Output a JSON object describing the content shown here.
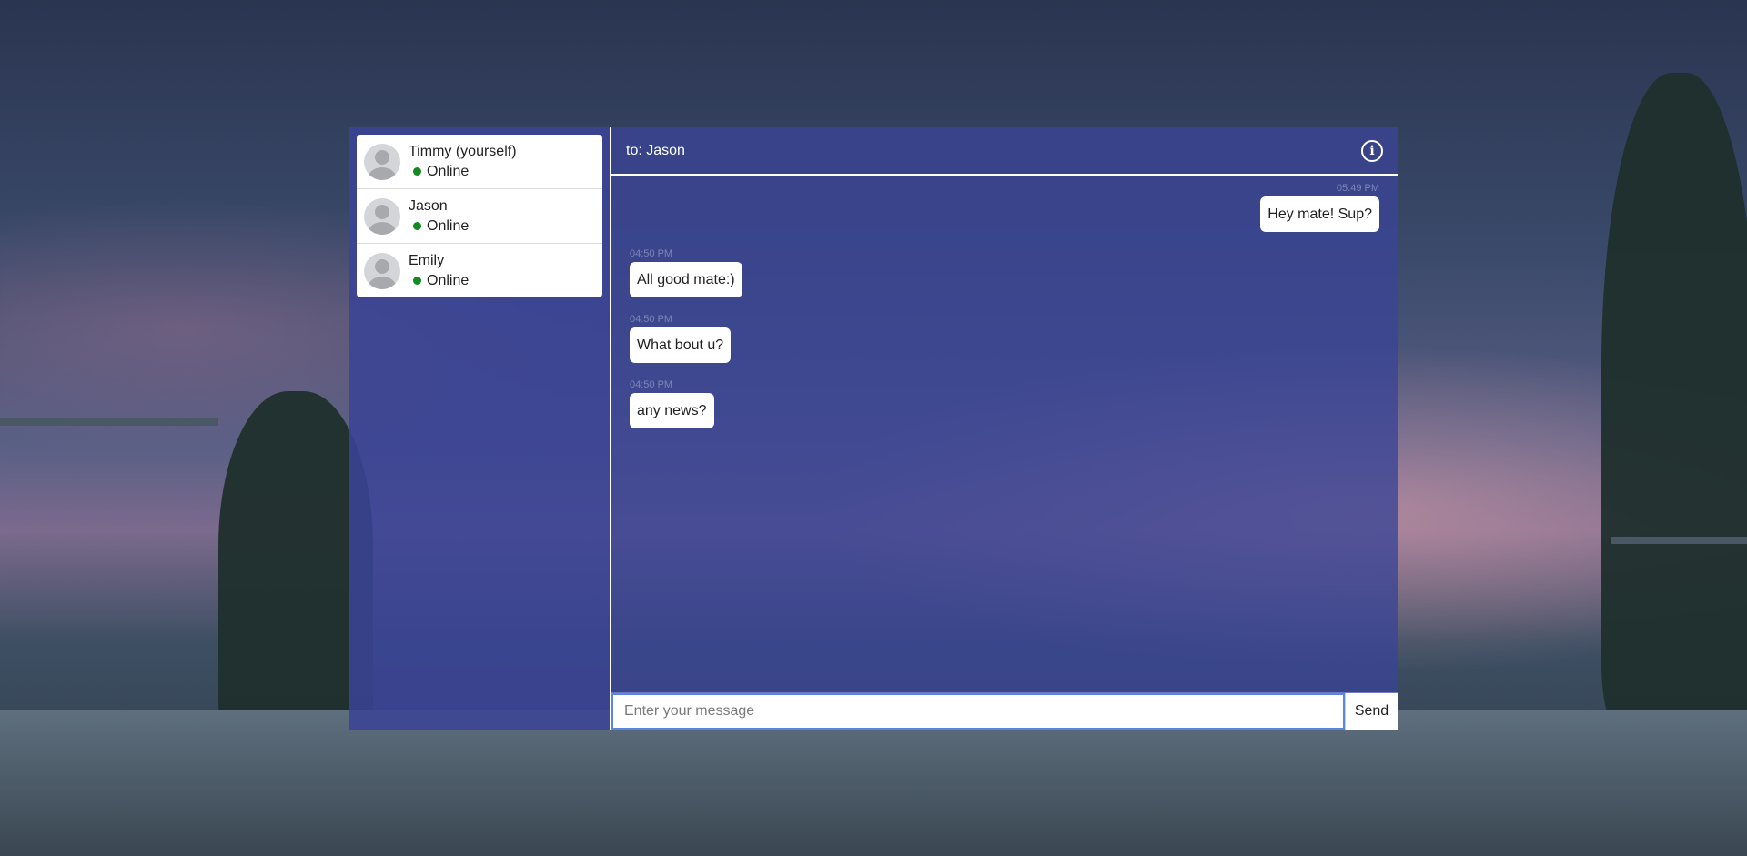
{
  "contacts": [
    {
      "name": "Timmy (yourself)",
      "status": "Online"
    },
    {
      "name": "Jason",
      "status": "Online"
    },
    {
      "name": "Emily",
      "status": "Online"
    }
  ],
  "chat": {
    "header": "to: Jason",
    "messages": [
      {
        "time": "05:49 PM",
        "text": "Hey mate! Sup?",
        "direction": "outgoing"
      },
      {
        "time": "04:50 PM",
        "text": "All good mate:)",
        "direction": "incoming"
      },
      {
        "time": "04:50 PM",
        "text": "What bout u?",
        "direction": "incoming"
      },
      {
        "time": "04:50 PM",
        "text": "any news?",
        "direction": "incoming"
      }
    ]
  },
  "input": {
    "placeholder": "Enter your message",
    "value": ""
  },
  "send_label": "Send",
  "icons": {
    "info": "info-icon",
    "avatar": "user-avatar-icon",
    "status": "online-dot-icon"
  },
  "colors": {
    "panel": "#3a4496",
    "online": "#138a1f",
    "input_border": "#5a86e0"
  }
}
